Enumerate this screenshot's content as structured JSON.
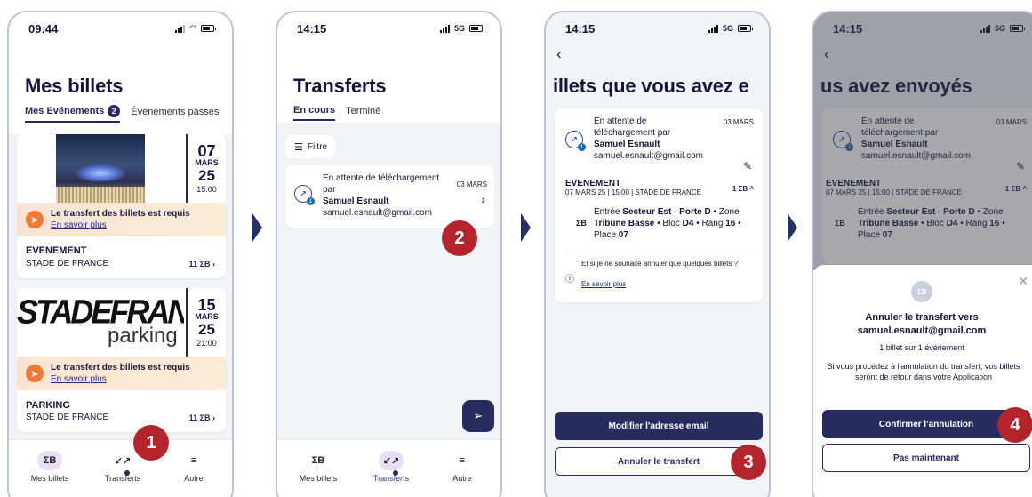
{
  "steps": [
    "1",
    "2",
    "3",
    "4"
  ],
  "icons": {
    "ticket": "ticket-icon",
    "transfer": "transfer-icon",
    "menu": "menu-icon",
    "send": "paper-plane-icon",
    "edit": "pencil-icon",
    "info": "info-icon",
    "close": "close-icon"
  },
  "colors": {
    "navy": "#262d5e",
    "callout": "#b3242d",
    "warning": "#ee7a3a"
  },
  "nav": {
    "tickets": "Mes billets",
    "transfers": "Transferts",
    "more": "Autre",
    "ticket_glyph": "ΣΒ",
    "transfer_glyph": "↙↗",
    "more_glyph": "≡"
  },
  "screen1": {
    "time": "09:44",
    "title": "Mes billets",
    "tabs": {
      "events": "Mes Evénements",
      "events_count": "2",
      "past": "Événements passés"
    },
    "events": [
      {
        "day": "07",
        "month": "MARS",
        "year": "25",
        "time": "15:00",
        "warning": "Le transfert des billets est requis",
        "link": "En savoir plus",
        "name": "EVENEMENT",
        "place": "STADE DE FRANCE",
        "count": "11 ΣΒ ›"
      },
      {
        "day": "15",
        "month": "MARS",
        "year": "25",
        "time": "21:00",
        "logo": "STADEFRANC",
        "logo_sub": "parking",
        "warning": "Le transfert des billets est requis",
        "link": "En savoir plus",
        "name": "PARKING",
        "place": "STADE DE FRANCE",
        "count": "11 ΣΒ ›"
      }
    ]
  },
  "screen2": {
    "time": "14:15",
    "network": "5G",
    "title": "Transferts",
    "tabs": {
      "current": "En cours",
      "done": "Terminé"
    },
    "filter": "Filtre",
    "item": {
      "status": "En attente de téléchargement par",
      "name": "Samuel Esnault",
      "email": "samuel.esnault@gmail.com",
      "date": "03 MARS"
    }
  },
  "screen3": {
    "time": "14:15",
    "network": "5G",
    "title": "illets que vous avez e",
    "item": {
      "status": "En attente de téléchargement par",
      "name": "Samuel Esnault",
      "email": "samuel.esnault@gmail.com",
      "date": "03 MARS"
    },
    "event": {
      "name": "EVENEMENT",
      "details": "07 MARS 25 | 15:00 | STADE DE FRANCE",
      "count": "1 ΣΒ ^"
    },
    "seat": {
      "l1a": "Entrée ",
      "l1b": "Secteur Est - Porte D",
      "l1c": " • Zone",
      "l2a": "Tribune Basse",
      "l2b": " • Bloc ",
      "l2c": "D4",
      "l2d": " • Rang ",
      "l2e": "16",
      "l2f": " •",
      "l3a": "Place ",
      "l3b": "07"
    },
    "cancel_q": "Et si je ne souhaite annuler que quelques billets ?",
    "link": "En savoir plus",
    "btn_modify": "Modifier l'adresse email",
    "btn_cancel": "Annuler le transfert"
  },
  "screen4": {
    "time": "14:15",
    "network": "5G",
    "title": "us avez envoyés",
    "item": {
      "status": "En attente de téléchargement par",
      "name": "Samuel Esnault",
      "email": "samuel.esnault@gmail.com",
      "date": "03 MARS"
    },
    "event": {
      "name": "EVENEMENT",
      "details": "07 MARS 25 | 15:00 | STADE DE FRANCE",
      "count": "1 ΣΒ ^"
    },
    "seat": {
      "l1a": "Entrée ",
      "l1b": "Secteur Est - Porte D",
      "l1c": " • Zone",
      "l2a": "Tribune Basse",
      "l2b": " • Bloc ",
      "l2c": "D4",
      "l2d": " • Rang ",
      "l2e": "16",
      "l2f": " •",
      "l3a": "Place ",
      "l3b": "07"
    },
    "sheet": {
      "title1": "Annuler le transfert vers",
      "title2": "samuel.esnault@gmail.com",
      "subtitle": "1 billet sur 1 événement",
      "body": "Si vous procédez à l'annulation du transfert, vos billets seront de retour dans votre Application",
      "confirm": "Confirmer l'annulation",
      "later": "Pas maintenant"
    }
  }
}
